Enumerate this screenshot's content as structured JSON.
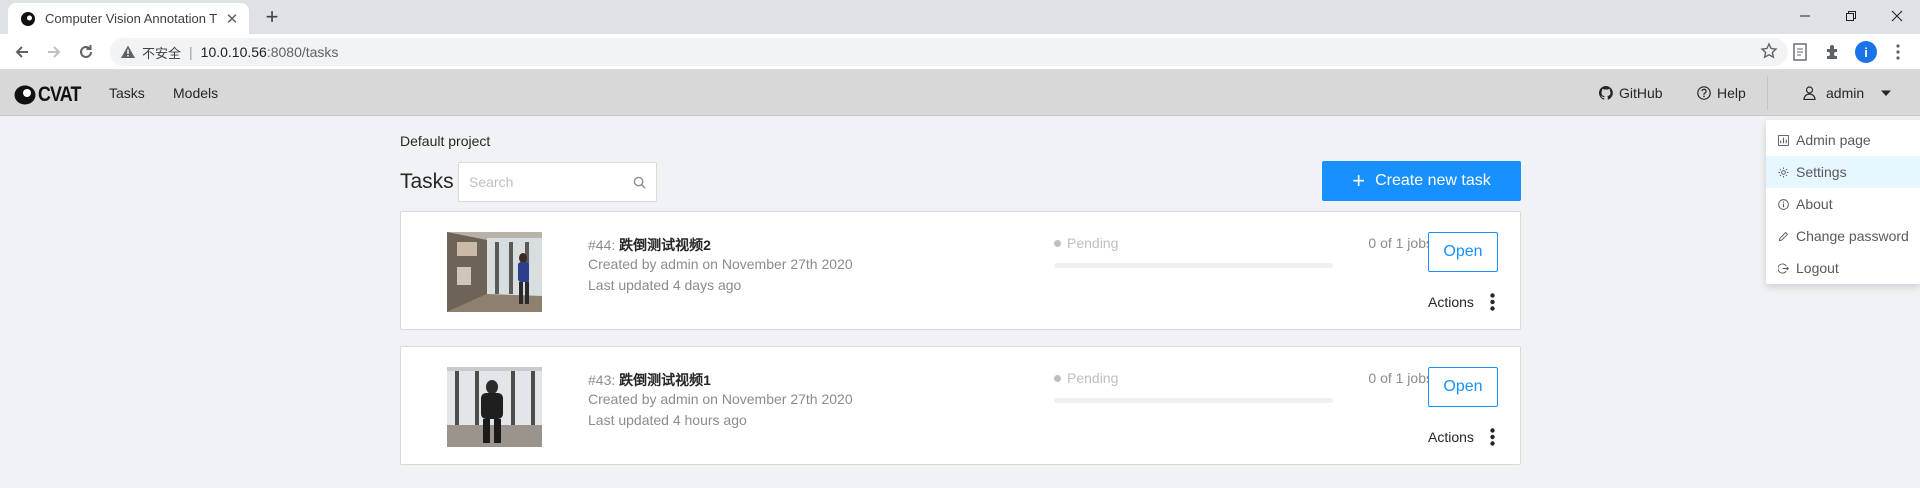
{
  "browser": {
    "tab_title": "Computer Vision Annotation T",
    "tab_close": "✕",
    "new_tab": "+",
    "security_label": "不安全",
    "url_host": "10.0.10.56",
    "url_path": ":8080/tasks",
    "profile_initial": "i"
  },
  "header": {
    "logo_text": "CVAT",
    "nav": {
      "tasks": "Tasks",
      "models": "Models"
    },
    "github": "GitHub",
    "help": "Help",
    "user": "admin"
  },
  "project_name": "Default project",
  "tasks_title": "Tasks",
  "search": {
    "placeholder": "Search"
  },
  "create_button": {
    "icon": "+",
    "label": "Create new task"
  },
  "tasks": [
    {
      "id": "#44: ",
      "name": "跌倒测试视频2",
      "created": "Created by admin on November 27th 2020",
      "updated": "Last updated 4 days ago",
      "status": "Pending",
      "jobs": "0 of 1 jobs",
      "progress": 0,
      "open_label": "Open",
      "actions_label": "Actions"
    },
    {
      "id": "#43: ",
      "name": "跌倒测试视频1",
      "created": "Created by admin on November 27th 2020",
      "updated": "Last updated 4 hours ago",
      "status": "Pending",
      "jobs": "0 of 1 jobs",
      "progress": 0,
      "open_label": "Open",
      "actions_label": "Actions"
    }
  ],
  "user_menu": {
    "items": [
      "Admin page",
      "Settings",
      "About",
      "Change password",
      "Logout"
    ],
    "active_index": 1
  },
  "colors": {
    "primary": "#1890ff",
    "header_bg": "#d8d8d8",
    "page_bg": "#f0f2f5",
    "menu_active": "#e6f7ff"
  }
}
